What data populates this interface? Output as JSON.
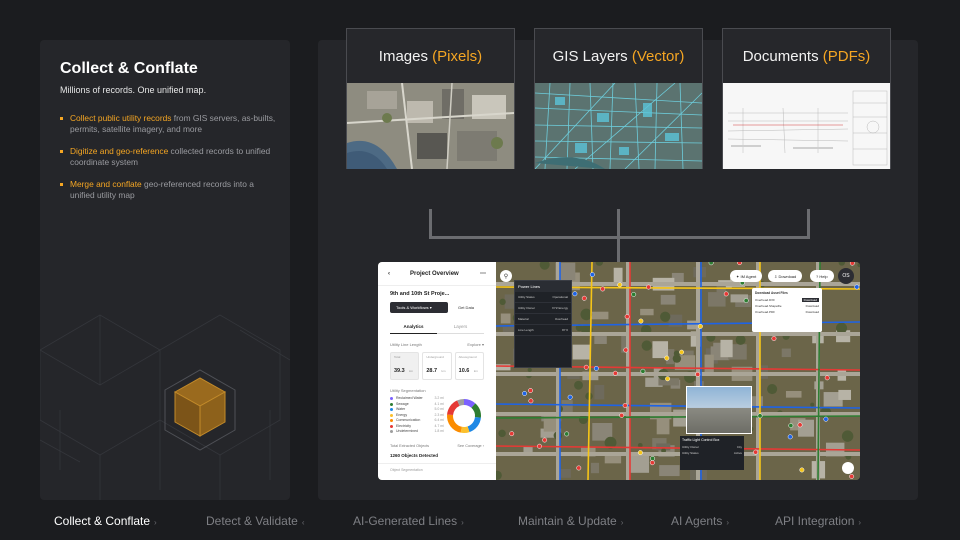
{
  "left": {
    "title": "Collect & Conflate",
    "subtitle": "Millions of records. One unified map.",
    "bullets": [
      {
        "highlight": "Collect public utility records",
        "rest": " from GIS servers, as-builts, permits, satellite imagery, and more"
      },
      {
        "highlight": "Digitize and geo-reference",
        "rest": " collected records to unified coordinate system"
      },
      {
        "highlight": "Merge and conflate",
        "rest": " geo-referenced records into a unified utility map"
      }
    ]
  },
  "cards": [
    {
      "title": "Images",
      "accent": "(Pixels)"
    },
    {
      "title": "GIS Layers",
      "accent": "(Vector)"
    },
    {
      "title": "Documents",
      "accent": "(PDFs)"
    }
  ],
  "app": {
    "header": "Project Overview",
    "project_name": "9th and 10th St Proje...",
    "tools_button": "Tools & Workflows",
    "get_data_button": "Get Data",
    "tab_analytics": "Analytics",
    "tab_layers": "Layers",
    "line_length_label": "Utility Line Length",
    "explore": "Explore",
    "stats": [
      {
        "label": "Total",
        "value": "39.3",
        "unit": "km"
      },
      {
        "label": "Underground",
        "value": "28.7",
        "unit": "km"
      },
      {
        "label": "Aboveground",
        "value": "10.6",
        "unit": "km"
      }
    ],
    "segmentation_label": "Utility Segmentation",
    "segments": [
      {
        "name": "Reclaimed Water",
        "value": "3.2 mi",
        "color": "#7b61ff"
      },
      {
        "name": "Sewage",
        "value": "4.1 mi",
        "color": "#2e7d32"
      },
      {
        "name": "Water",
        "value": "5.0 mi",
        "color": "#1e88e5"
      },
      {
        "name": "Energy",
        "value": "2.3 mi",
        "color": "#fbc02d"
      },
      {
        "name": "Communication",
        "value": "6.4 mi",
        "color": "#fb8c00"
      },
      {
        "name": "Electricity",
        "value": "4.7 mi",
        "color": "#e53935"
      },
      {
        "name": "Undetermined",
        "value": "1.8 mi",
        "color": "#9e9e9e"
      }
    ],
    "total_extracted": "Total Extracted Objects",
    "see_coverage": "See Coverage",
    "objects_detected": "1260 Objects Detected",
    "object_segmentation": "Object Segmentation",
    "map": {
      "agent_button": "IM Agent",
      "download_button": "Download",
      "help_button": "Help",
      "avatar": "OS",
      "power_lines_title": "Power Lines",
      "power_rows": [
        [
          "Utility Status",
          "Operational"
        ],
        [
          "Utility Owner",
          "XYZ Energy"
        ],
        [
          "Material",
          "Overhead"
        ],
        [
          "Line Length",
          "87 ft"
        ]
      ],
      "download_title": "Download Asset Files",
      "download_rows": [
        [
          "Overhead.DXF",
          "Download"
        ],
        [
          "Overhead.Shapefile",
          "Download"
        ],
        [
          "Overhead.PDF",
          "Download"
        ]
      ],
      "traffic_title": "Traffic Light Control Box",
      "traffic_rows": [
        [
          "Utility Owner",
          "City"
        ],
        [
          "Utility Status",
          "Active"
        ]
      ]
    }
  },
  "nav": [
    {
      "label": "Collect & Conflate",
      "active": true
    },
    {
      "label": "Detect & Validate",
      "active": false
    },
    {
      "label": "AI-Generated Lines",
      "active": false
    },
    {
      "label": "Maintain & Update",
      "active": false
    },
    {
      "label": "AI Agents",
      "active": false
    },
    {
      "label": "API Integration",
      "active": false
    }
  ],
  "colors": {
    "accent": "#f5a623",
    "background": "#1b1c1f",
    "panel": "#25262a"
  }
}
